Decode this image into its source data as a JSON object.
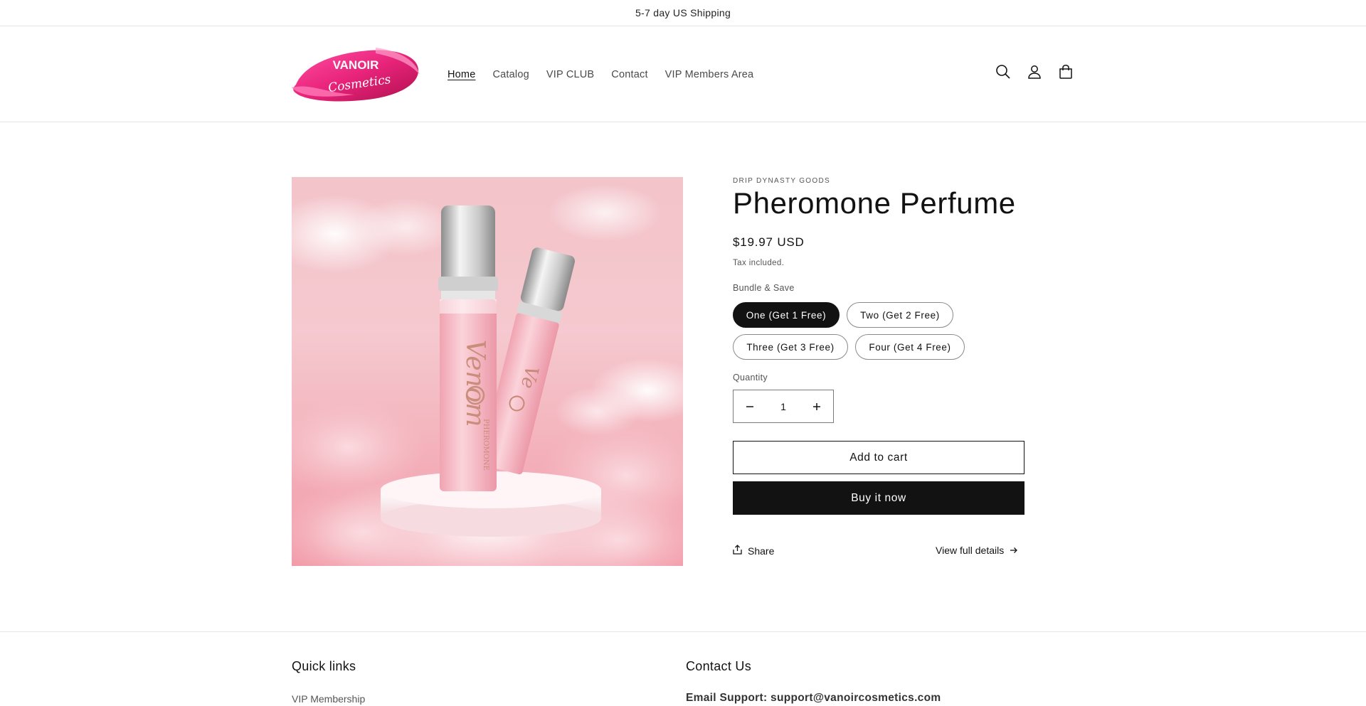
{
  "announcement": "5-7 day US Shipping",
  "brand": {
    "logo_line1": "VANOIR",
    "logo_line2": "Cosmetics",
    "accent": "#e8237a"
  },
  "nav": {
    "items": [
      {
        "label": "Home",
        "active": true
      },
      {
        "label": "Catalog"
      },
      {
        "label": "VIP CLUB"
      },
      {
        "label": "Contact"
      },
      {
        "label": "VIP Members Area"
      }
    ]
  },
  "header_icons": [
    "search-icon",
    "account-icon",
    "cart-icon"
  ],
  "product": {
    "vendor": "DRIP DYNASTY GOODS",
    "title": "Pheromone Perfume",
    "price": "$19.97 USD",
    "tax_note": "Tax included.",
    "bundle_label": "Bundle & Save",
    "bundle_options": [
      {
        "label": "One (Get 1 Free)",
        "selected": true
      },
      {
        "label": "Two (Get 2 Free)"
      },
      {
        "label": "Three (Get 3 Free)"
      },
      {
        "label": "Four (Get 4 Free)"
      }
    ],
    "quantity_label": "Quantity",
    "quantity": "1",
    "add_to_cart": "Add to cart",
    "buy_now": "Buy it now",
    "share": "Share",
    "view_details": "View full details",
    "image_bottle_text": "Venom",
    "image_bottle_subtext": "PHEROMONE"
  },
  "footer": {
    "quick_links_heading": "Quick links",
    "quick_links": [
      "VIP Membership"
    ],
    "contact_heading": "Contact Us",
    "email_support": "Email Support: support@vanoircosmetics.com"
  }
}
